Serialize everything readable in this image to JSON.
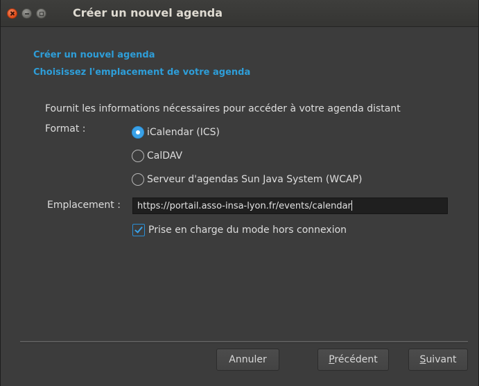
{
  "window": {
    "title": "Créer un nouvel agenda"
  },
  "header": {
    "line1": "Créer un nouvel agenda",
    "line2": "Choisissez l'emplacement de votre agenda"
  },
  "form": {
    "intro": "Fournit les informations nécessaires pour accéder à votre agenda distant",
    "format_label": "Format :",
    "format_options": [
      {
        "label": "iCalendar (ICS)",
        "selected": true
      },
      {
        "label": "CalDAV",
        "selected": false
      },
      {
        "label": "Serveur d'agendas Sun Java System (WCAP)",
        "selected": false
      }
    ],
    "location_label": "Emplacement :",
    "location_value": "https://portail.asso-insa-lyon.fr/events/calendar",
    "offline_label": "Prise en charge du mode hors connexion",
    "offline_checked": true
  },
  "buttons": {
    "cancel": "Annuler",
    "previous_mnemonic": "P",
    "previous_rest": "récédent",
    "next_mnemonic": "S",
    "next_rest": "uivant"
  },
  "colors": {
    "accent": "#3aa1e7",
    "heading": "#2e9ed9",
    "close_button": "#df4a16"
  }
}
